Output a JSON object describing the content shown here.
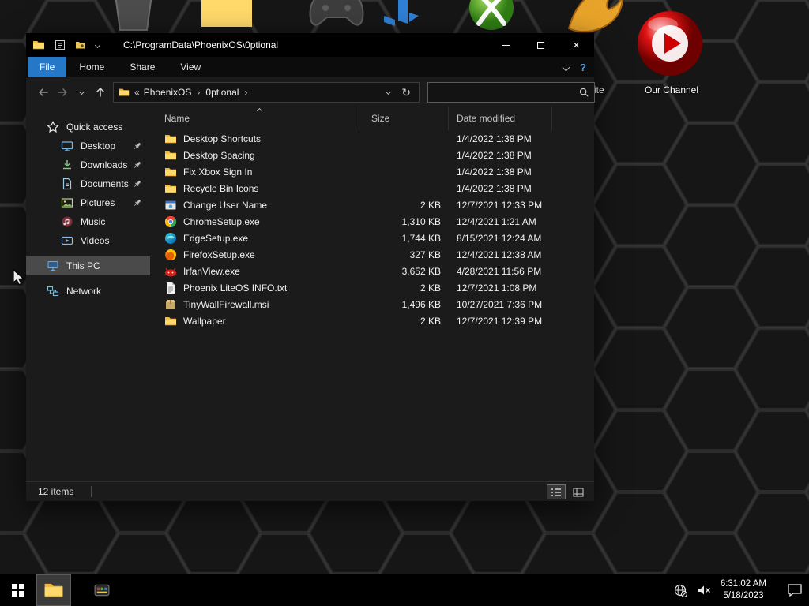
{
  "titlebar": {
    "title": "C:\\ProgramData\\PhoenixOS\\0ptional"
  },
  "ribbon": {
    "tabs": [
      {
        "label": "File",
        "active": true
      },
      {
        "label": "Home",
        "active": false
      },
      {
        "label": "Share",
        "active": false
      },
      {
        "label": "View",
        "active": false
      }
    ]
  },
  "address": {
    "breadcrumb": [
      "PhoenixOS",
      "0ptional"
    ],
    "separator": "›",
    "overflow": "«"
  },
  "search": {
    "placeholder": "",
    "value": ""
  },
  "columns": [
    "Name",
    "Size",
    "Date modified"
  ],
  "sidebar": {
    "items": [
      {
        "label": "Quick access",
        "icon": "star",
        "child": false,
        "pinned": false,
        "selected": false,
        "gap": false
      },
      {
        "label": "Desktop",
        "icon": "desktop",
        "child": true,
        "pinned": true,
        "selected": false,
        "gap": false
      },
      {
        "label": "Downloads",
        "icon": "download",
        "child": true,
        "pinned": true,
        "selected": false,
        "gap": false
      },
      {
        "label": "Documents",
        "icon": "document",
        "child": true,
        "pinned": true,
        "selected": false,
        "gap": false
      },
      {
        "label": "Pictures",
        "icon": "pictures",
        "child": true,
        "pinned": true,
        "selected": false,
        "gap": false
      },
      {
        "label": "Music",
        "icon": "music",
        "child": true,
        "pinned": false,
        "selected": false,
        "gap": false
      },
      {
        "label": "Videos",
        "icon": "videos",
        "child": true,
        "pinned": false,
        "selected": false,
        "gap": false
      },
      {
        "label": "This PC",
        "icon": "pc",
        "child": false,
        "pinned": false,
        "selected": true,
        "gap": true
      },
      {
        "label": "Network",
        "icon": "network",
        "child": false,
        "pinned": false,
        "selected": false,
        "gap": true
      }
    ]
  },
  "files": [
    {
      "name": "Desktop Shortcuts",
      "icon": "folder",
      "size": "",
      "date": "1/4/2022 1:38 PM"
    },
    {
      "name": "Desktop Spacing",
      "icon": "folder",
      "size": "",
      "date": "1/4/2022 1:38 PM"
    },
    {
      "name": "Fix Xbox Sign In",
      "icon": "folder",
      "size": "",
      "date": "1/4/2022 1:38 PM"
    },
    {
      "name": "Recycle Bin Icons",
      "icon": "folder",
      "size": "",
      "date": "1/4/2022 1:38 PM"
    },
    {
      "name": "Change User Name",
      "icon": "app",
      "size": "2 KB",
      "date": "12/7/2021 12:33 PM"
    },
    {
      "name": "ChromeSetup.exe",
      "icon": "chrome",
      "size": "1,310 KB",
      "date": "12/4/2021 1:21 AM"
    },
    {
      "name": "EdgeSetup.exe",
      "icon": "edge",
      "size": "1,744 KB",
      "date": "8/15/2021 12:24 AM"
    },
    {
      "name": "FirefoxSetup.exe",
      "icon": "firefox",
      "size": "327 KB",
      "date": "12/4/2021 12:38 AM"
    },
    {
      "name": "IrfanView.exe",
      "icon": "irfanview",
      "size": "3,652 KB",
      "date": "4/28/2021 11:56 PM"
    },
    {
      "name": "Phoenix LiteOS INFO.txt",
      "icon": "txt",
      "size": "2 KB",
      "date": "12/7/2021 1:08 PM"
    },
    {
      "name": "TinyWallFirewall.msi",
      "icon": "msi",
      "size": "1,496 KB",
      "date": "10/27/2021 7:36 PM"
    },
    {
      "name": "Wallpaper",
      "icon": "folder",
      "size": "2 KB",
      "date": "12/7/2021 12:39 PM"
    }
  ],
  "statusbar": {
    "items_count": "12 items"
  },
  "desktop": {
    "our_channel_label": "Our Channel",
    "site_label": "site"
  },
  "taskbar": {
    "time": "6:31:02 AM",
    "date": "5/18/2023"
  },
  "colors": {
    "accent_blue": "#2577c8",
    "folder_yellow": "#ffd96a",
    "orb_red": "#d20a0a"
  }
}
